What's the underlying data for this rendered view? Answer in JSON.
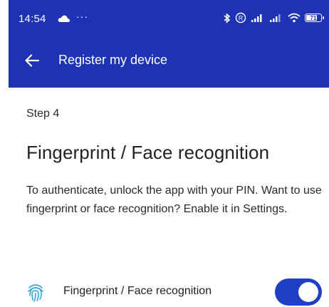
{
  "status_bar": {
    "time": "14:54",
    "dots": "···",
    "battery": "71"
  },
  "app_bar": {
    "title": "Register my device"
  },
  "content": {
    "step": "Step 4",
    "title": "Fingerprint / Face recognition",
    "description": "To authenticate, unlock the app with your PIN. Want to use fingerprint or face recognition? Enable it in Settings."
  },
  "setting": {
    "label": "Fingerprint / Face recognition",
    "enabled": true
  },
  "colors": {
    "primary": "#1e33b3",
    "toggle_on": "#1e3ec4"
  }
}
